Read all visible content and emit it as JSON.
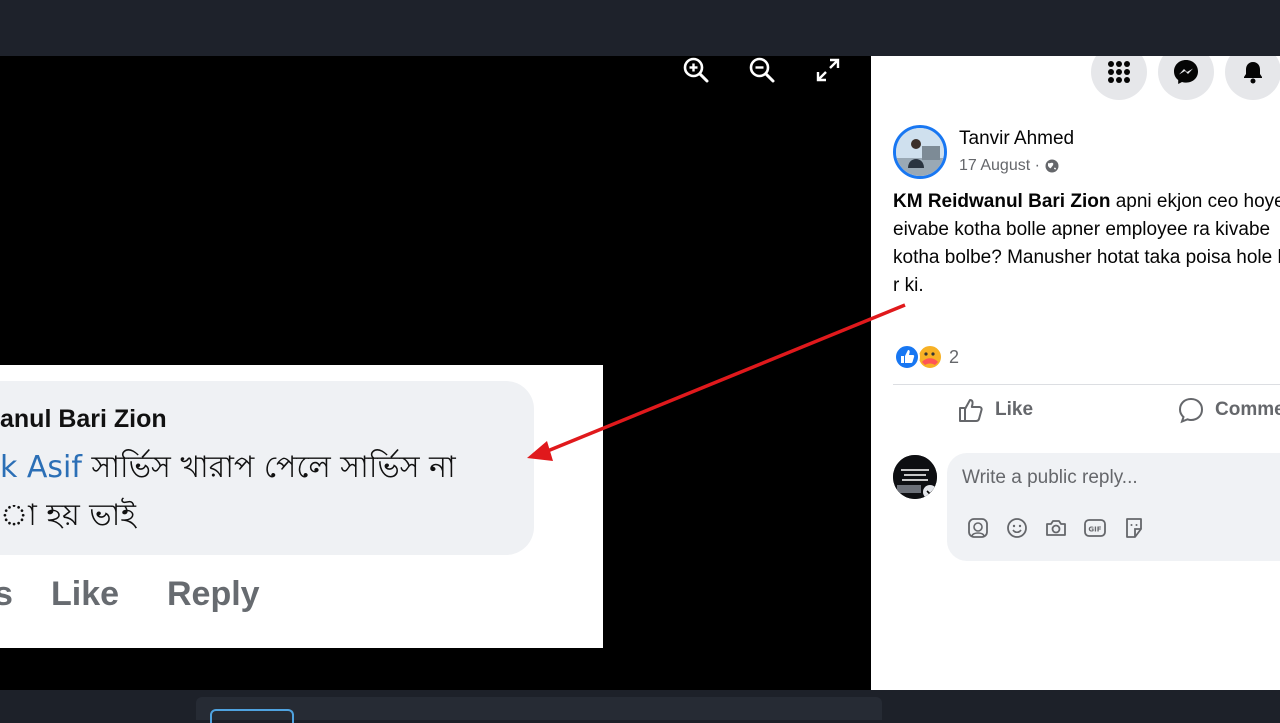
{
  "viewer": {
    "controls": [
      {
        "icon": "zoom-in-icon"
      },
      {
        "icon": "zoom-out-icon"
      },
      {
        "icon": "fullscreen-icon"
      }
    ],
    "photo": {
      "commenter_name": "anul Bari Zion",
      "line1_mention": "k Asif",
      "line1_text": " সার্ভিস খারাপ পেলে সার্ভিস না",
      "line2_text": "া হয় ভাই",
      "action_partial": "s",
      "like_label": "Like",
      "reply_label": "Reply"
    }
  },
  "header_buttons": [
    {
      "icon": "menu-grid-icon"
    },
    {
      "icon": "messenger-icon"
    },
    {
      "icon": "bell-icon"
    }
  ],
  "post": {
    "author": "Tanvir Ahmed",
    "date": "17 August ·",
    "privacy_icon": "globe-icon",
    "mention": "KM Reidwanul Bari Zion",
    "text": " apni ekjon ceo hoye eivabe kotha bolle apner employee ra kivabe kotha bolbe? Manusher hotat taka poisa hole hoy r ki.",
    "reaction_count": "2",
    "like_label": "Like",
    "comment_label": "Comment"
  },
  "reply_box": {
    "placeholder": "Write a public reply...",
    "icons": [
      "avatar-sticker-icon",
      "emoji-icon",
      "camera-icon",
      "gif-icon",
      "sticker-icon"
    ]
  },
  "colors": {
    "accent": "#1877f2",
    "arrow": "#e0191c",
    "mention_blue": "#2b6fb6"
  }
}
